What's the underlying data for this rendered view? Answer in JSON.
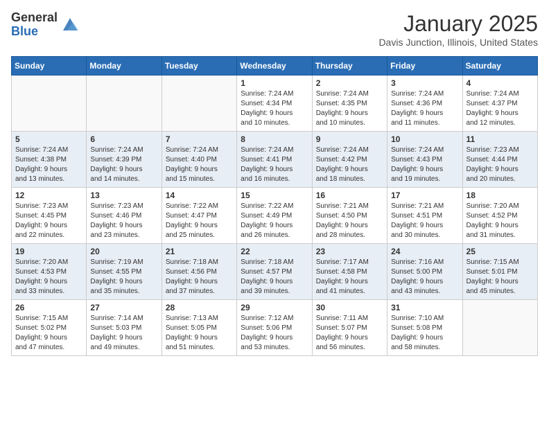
{
  "header": {
    "logo_general": "General",
    "logo_blue": "Blue",
    "month": "January 2025",
    "location": "Davis Junction, Illinois, United States"
  },
  "days_of_week": [
    "Sunday",
    "Monday",
    "Tuesday",
    "Wednesday",
    "Thursday",
    "Friday",
    "Saturday"
  ],
  "weeks": [
    [
      {
        "day": "",
        "content": ""
      },
      {
        "day": "",
        "content": ""
      },
      {
        "day": "",
        "content": ""
      },
      {
        "day": "1",
        "content": "Sunrise: 7:24 AM\nSunset: 4:34 PM\nDaylight: 9 hours\nand 10 minutes."
      },
      {
        "day": "2",
        "content": "Sunrise: 7:24 AM\nSunset: 4:35 PM\nDaylight: 9 hours\nand 10 minutes."
      },
      {
        "day": "3",
        "content": "Sunrise: 7:24 AM\nSunset: 4:36 PM\nDaylight: 9 hours\nand 11 minutes."
      },
      {
        "day": "4",
        "content": "Sunrise: 7:24 AM\nSunset: 4:37 PM\nDaylight: 9 hours\nand 12 minutes."
      }
    ],
    [
      {
        "day": "5",
        "content": "Sunrise: 7:24 AM\nSunset: 4:38 PM\nDaylight: 9 hours\nand 13 minutes."
      },
      {
        "day": "6",
        "content": "Sunrise: 7:24 AM\nSunset: 4:39 PM\nDaylight: 9 hours\nand 14 minutes."
      },
      {
        "day": "7",
        "content": "Sunrise: 7:24 AM\nSunset: 4:40 PM\nDaylight: 9 hours\nand 15 minutes."
      },
      {
        "day": "8",
        "content": "Sunrise: 7:24 AM\nSunset: 4:41 PM\nDaylight: 9 hours\nand 16 minutes."
      },
      {
        "day": "9",
        "content": "Sunrise: 7:24 AM\nSunset: 4:42 PM\nDaylight: 9 hours\nand 18 minutes."
      },
      {
        "day": "10",
        "content": "Sunrise: 7:24 AM\nSunset: 4:43 PM\nDaylight: 9 hours\nand 19 minutes."
      },
      {
        "day": "11",
        "content": "Sunrise: 7:23 AM\nSunset: 4:44 PM\nDaylight: 9 hours\nand 20 minutes."
      }
    ],
    [
      {
        "day": "12",
        "content": "Sunrise: 7:23 AM\nSunset: 4:45 PM\nDaylight: 9 hours\nand 22 minutes."
      },
      {
        "day": "13",
        "content": "Sunrise: 7:23 AM\nSunset: 4:46 PM\nDaylight: 9 hours\nand 23 minutes."
      },
      {
        "day": "14",
        "content": "Sunrise: 7:22 AM\nSunset: 4:47 PM\nDaylight: 9 hours\nand 25 minutes."
      },
      {
        "day": "15",
        "content": "Sunrise: 7:22 AM\nSunset: 4:49 PM\nDaylight: 9 hours\nand 26 minutes."
      },
      {
        "day": "16",
        "content": "Sunrise: 7:21 AM\nSunset: 4:50 PM\nDaylight: 9 hours\nand 28 minutes."
      },
      {
        "day": "17",
        "content": "Sunrise: 7:21 AM\nSunset: 4:51 PM\nDaylight: 9 hours\nand 30 minutes."
      },
      {
        "day": "18",
        "content": "Sunrise: 7:20 AM\nSunset: 4:52 PM\nDaylight: 9 hours\nand 31 minutes."
      }
    ],
    [
      {
        "day": "19",
        "content": "Sunrise: 7:20 AM\nSunset: 4:53 PM\nDaylight: 9 hours\nand 33 minutes."
      },
      {
        "day": "20",
        "content": "Sunrise: 7:19 AM\nSunset: 4:55 PM\nDaylight: 9 hours\nand 35 minutes."
      },
      {
        "day": "21",
        "content": "Sunrise: 7:18 AM\nSunset: 4:56 PM\nDaylight: 9 hours\nand 37 minutes."
      },
      {
        "day": "22",
        "content": "Sunrise: 7:18 AM\nSunset: 4:57 PM\nDaylight: 9 hours\nand 39 minutes."
      },
      {
        "day": "23",
        "content": "Sunrise: 7:17 AM\nSunset: 4:58 PM\nDaylight: 9 hours\nand 41 minutes."
      },
      {
        "day": "24",
        "content": "Sunrise: 7:16 AM\nSunset: 5:00 PM\nDaylight: 9 hours\nand 43 minutes."
      },
      {
        "day": "25",
        "content": "Sunrise: 7:15 AM\nSunset: 5:01 PM\nDaylight: 9 hours\nand 45 minutes."
      }
    ],
    [
      {
        "day": "26",
        "content": "Sunrise: 7:15 AM\nSunset: 5:02 PM\nDaylight: 9 hours\nand 47 minutes."
      },
      {
        "day": "27",
        "content": "Sunrise: 7:14 AM\nSunset: 5:03 PM\nDaylight: 9 hours\nand 49 minutes."
      },
      {
        "day": "28",
        "content": "Sunrise: 7:13 AM\nSunset: 5:05 PM\nDaylight: 9 hours\nand 51 minutes."
      },
      {
        "day": "29",
        "content": "Sunrise: 7:12 AM\nSunset: 5:06 PM\nDaylight: 9 hours\nand 53 minutes."
      },
      {
        "day": "30",
        "content": "Sunrise: 7:11 AM\nSunset: 5:07 PM\nDaylight: 9 hours\nand 56 minutes."
      },
      {
        "day": "31",
        "content": "Sunrise: 7:10 AM\nSunset: 5:08 PM\nDaylight: 9 hours\nand 58 minutes."
      },
      {
        "day": "",
        "content": ""
      }
    ]
  ]
}
